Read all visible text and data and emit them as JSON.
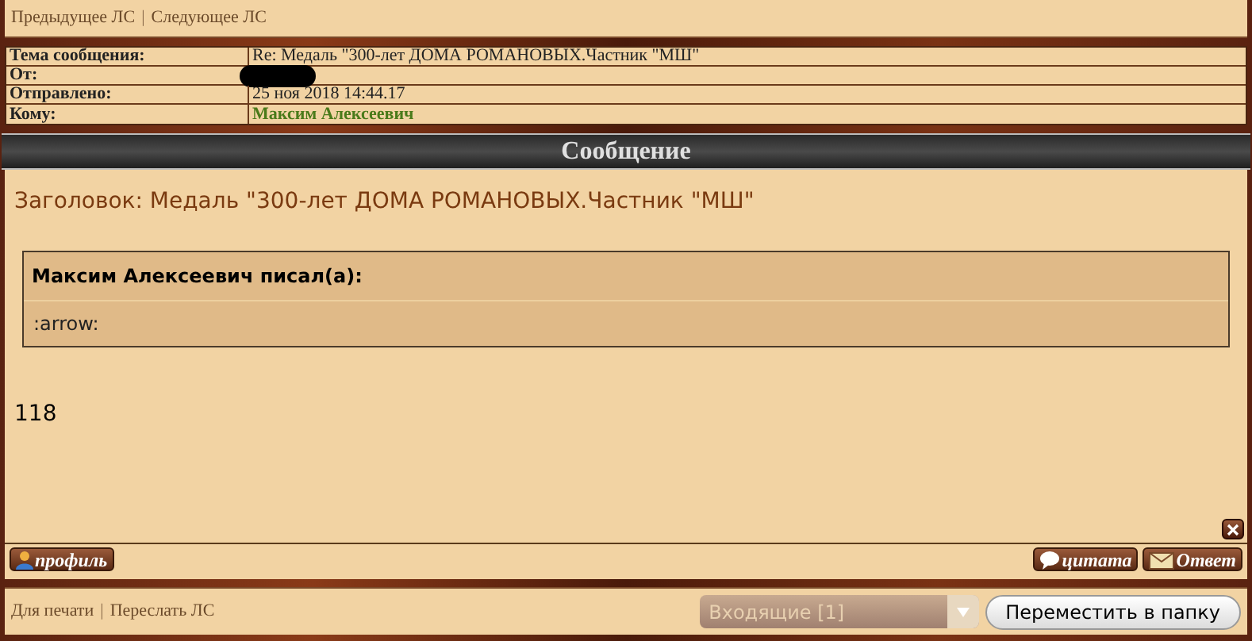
{
  "link_separator": "|",
  "top_links": [
    "Предыдущее ЛС",
    "Следующее ЛС"
  ],
  "header_rows": [
    {
      "kind": "text",
      "label": "Тема сообщения:",
      "value": "Re: Медаль \"300-лет ДОМА РОМАНОВЫХ.Частник \"МШ\""
    },
    {
      "kind": "redacted",
      "label": "От:"
    },
    {
      "kind": "text",
      "label": "Отправлено:",
      "value": "25 ноя 2018 14:44.17"
    },
    {
      "kind": "user",
      "label": "Кому:",
      "value": "Максим Алексеевич"
    }
  ],
  "section_title": "Сообщение",
  "message": {
    "subject": "Заголовок: Медаль \"300-лет ДОМА РОМАНОВЫХ.Частник \"МШ\"",
    "quote": {
      "author": "Максим Алексеевич писал(а):",
      "text": ":arrow:"
    },
    "body": "118"
  },
  "buttons": {
    "profile": "профиль",
    "quote": "цитата",
    "reply": "Ответ"
  },
  "bottom_links": [
    "Для печати",
    "Переслать ЛС"
  ],
  "folder_select": {
    "value": "Входящие [1]",
    "disabled": true
  },
  "move_button": "Переместить в папку"
}
